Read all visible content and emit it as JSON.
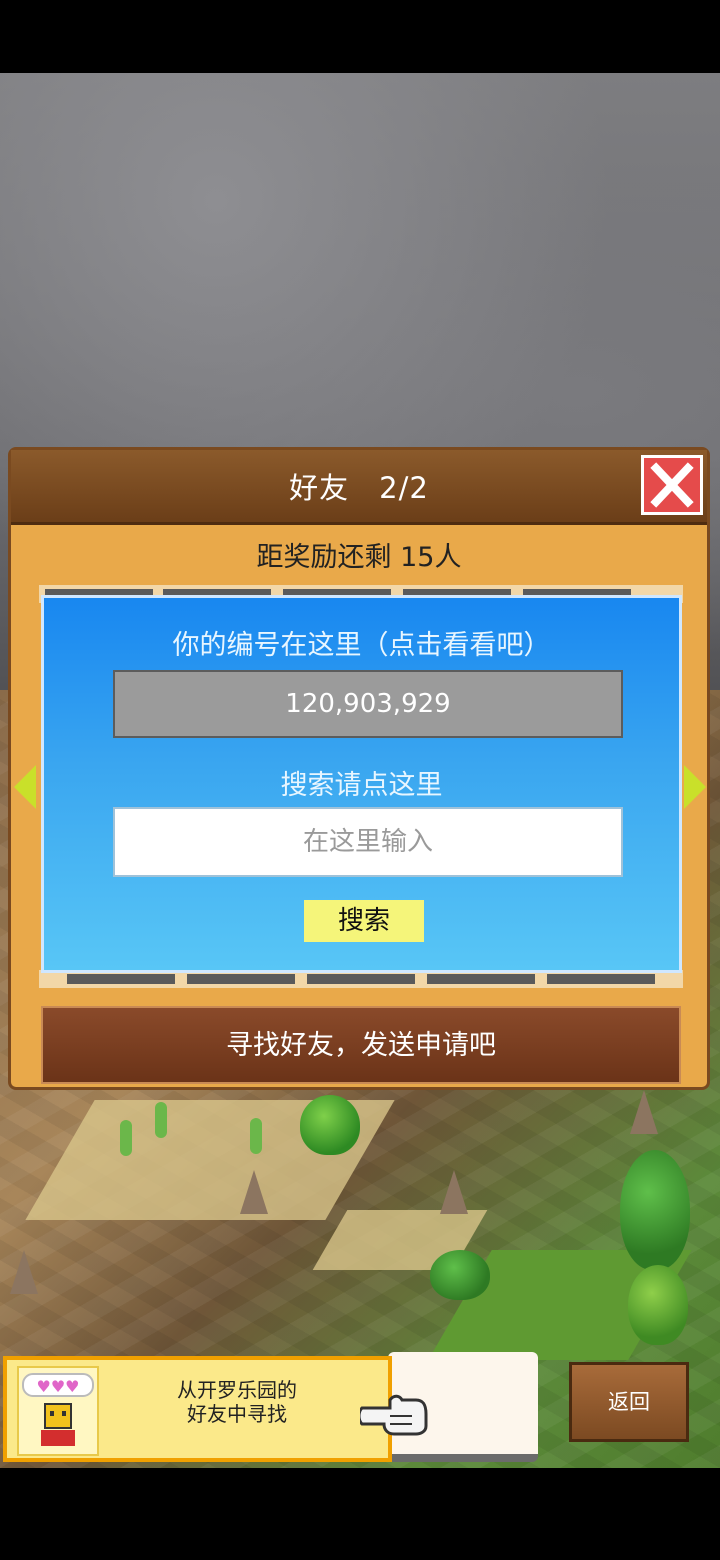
{
  "dialog": {
    "title": "好友　2/2",
    "close_icon": "close-icon",
    "reward_text": "距奖励还剩 15人",
    "id_label": "你的编号在这里（点击看看吧）",
    "id_value": "120,903,929",
    "search_label": "搜索请点这里",
    "search_placeholder": "在这里输入",
    "search_button": "搜索",
    "find_button": "寻找好友，发送申请吧",
    "nav_left_icon": "arrow-left-icon",
    "nav_right_icon": "arrow-right-icon"
  },
  "footer": {
    "kairo_text": "从开罗乐园的\n好友中寻找",
    "back_button": "返回",
    "hand_icon": "pointing-hand-icon"
  },
  "colors": {
    "panel_blue": "#1887f0",
    "dialog_orange": "#e9a94a",
    "close_red": "#e54b4b",
    "search_yellow": "#f5f57a"
  }
}
